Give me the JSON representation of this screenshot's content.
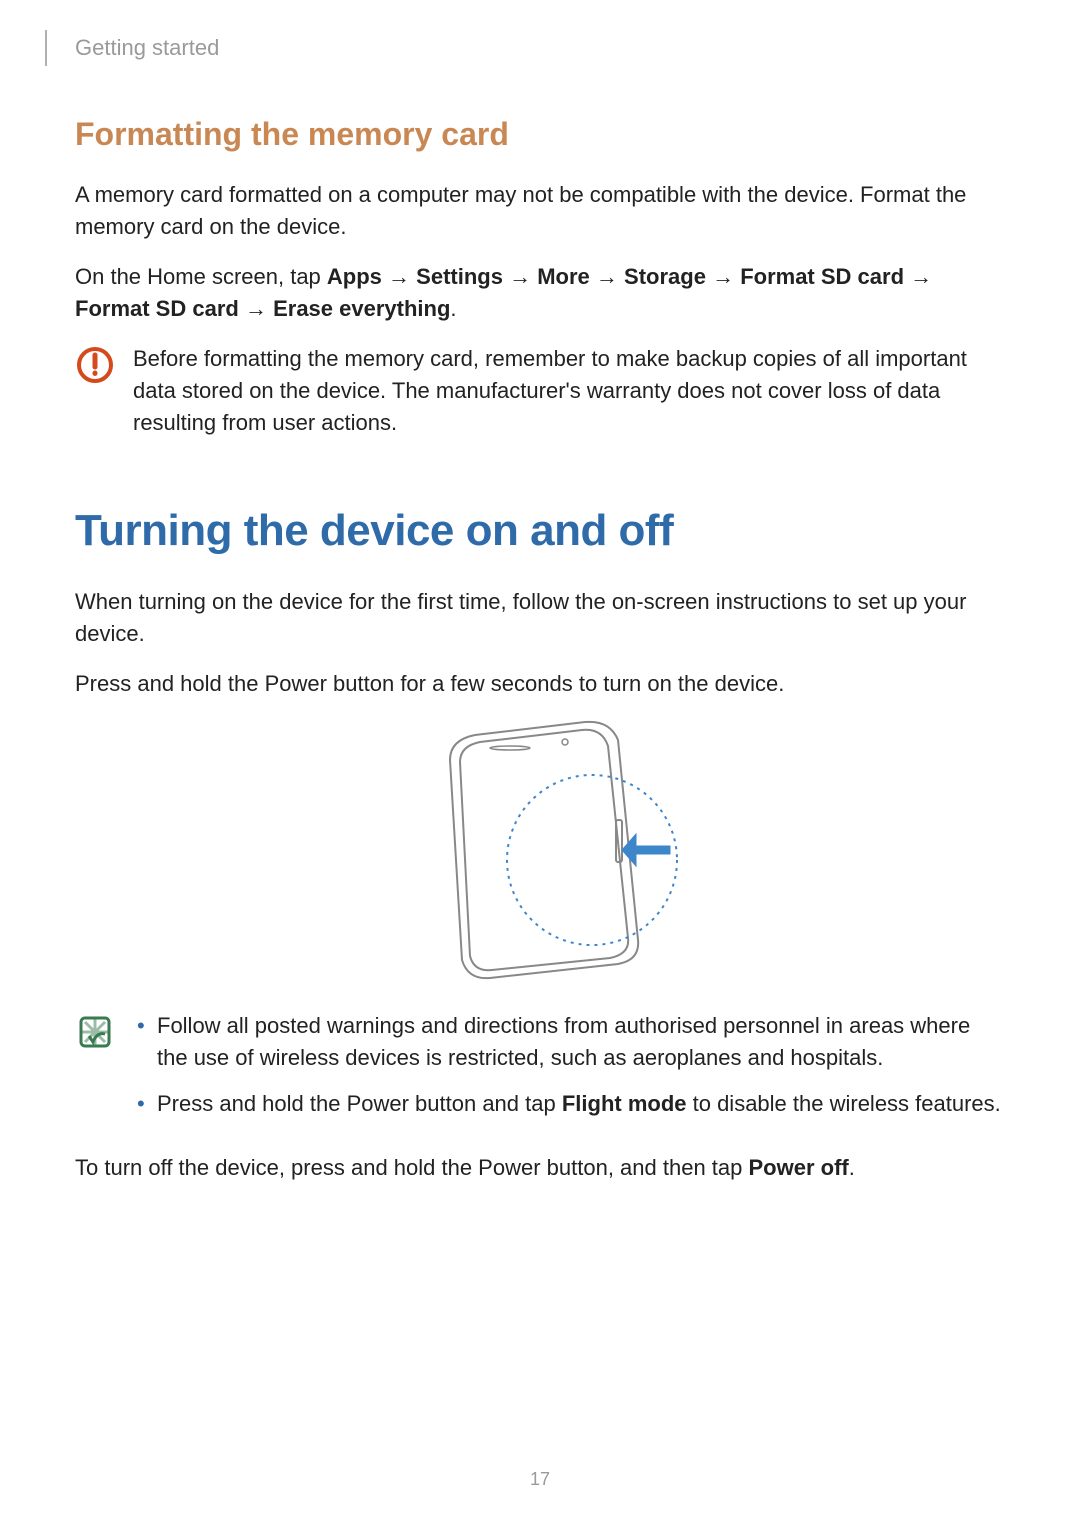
{
  "header": {
    "breadcrumb": "Getting started"
  },
  "section1": {
    "title": "Formatting the memory card",
    "p1": "A memory card formatted on a computer may not be compatible with the device. Format the memory card on the device.",
    "p2_prefix": "On the Home screen, tap ",
    "p2_b1": "Apps",
    "p2_b2": "Settings",
    "p2_b3": "More",
    "p2_b4": "Storage",
    "p2_b5": "Format SD card",
    "p2_b6": "Format SD card",
    "p2_b7": "Erase everything",
    "arrow": "→",
    "caution_text": "Before formatting the memory card, remember to make backup copies of all important data stored on the device. The manufacturer's warranty does not cover loss of data resulting from user actions."
  },
  "section2": {
    "title": "Turning the device on and off",
    "p1": "When turning on the device for the first time, follow the on-screen instructions to set up your device.",
    "p2": "Press and hold the Power button for a few seconds to turn on the device.",
    "note_bullet1": "Follow all posted warnings and directions from authorised personnel in areas where the use of wireless devices is restricted, such as aeroplanes and hospitals.",
    "note_bullet2_pre": "Press and hold the Power button and tap ",
    "note_bullet2_bold": "Flight mode",
    "note_bullet2_post": " to disable the wireless features.",
    "p3_pre": "To turn off the device, press and hold the Power button, and then tap ",
    "p3_bold": "Power off",
    "p3_post": "."
  },
  "page_number": "17"
}
